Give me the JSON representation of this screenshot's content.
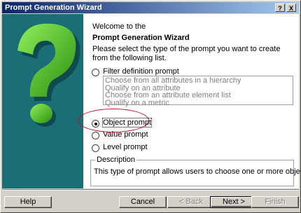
{
  "window": {
    "title": "Prompt Generation Wizard"
  },
  "titlebar_buttons": {
    "help": "?",
    "close": "X"
  },
  "content": {
    "welcome": "Welcome to the",
    "heading": "Prompt Generation Wizard",
    "instructions": "Please select the type of the prompt you want to create from the following list.",
    "options": [
      {
        "label": "Filter definition prompt",
        "mnemonic": "i",
        "checked": false
      },
      {
        "label": "Object prompt",
        "mnemonic": "O",
        "checked": true
      },
      {
        "label": "Value prompt",
        "mnemonic": "V",
        "checked": false
      },
      {
        "label": "Level prompt",
        "mnemonic": "L",
        "checked": false
      }
    ],
    "filter_suboptions": [
      "Choose from all attributes in a hierarchy",
      "Qualify on an attribute",
      "Choose from an attribute element list",
      "Qualify on a metric"
    ],
    "description": {
      "legend": "Description",
      "text": "This type of prompt allows users to choose one or more objects."
    }
  },
  "buttons": {
    "help": "Help",
    "cancel": "Cancel",
    "back": "< Back",
    "next": "Next >",
    "finish": "Finish"
  },
  "colors": {
    "side_panel": "#1a6e76",
    "question_mark": "#5ad12a",
    "highlight_ellipse": "#c8102e"
  }
}
